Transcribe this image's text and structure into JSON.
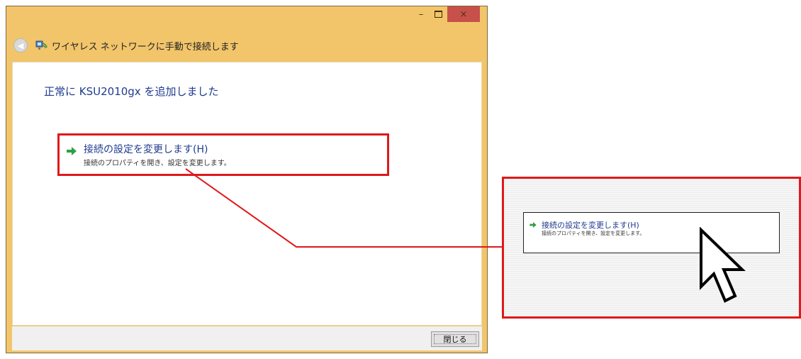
{
  "window": {
    "controls": {
      "minimize": "–",
      "maximize": "",
      "close": "×"
    },
    "address_title": "ワイヤレス ネットワークに手動で接続します",
    "heading": "正常に KSU2010gx を追加しました",
    "link": {
      "title": "接続の設定を変更します(H)",
      "description": "接続のプロパティを開き、設定を変更します。"
    },
    "close_button": "閉じる"
  },
  "callout": {
    "link": {
      "title": "接続の設定を変更します(H)",
      "description": "接続のプロパティを開き、設定を変更します。"
    }
  },
  "colors": {
    "window_frame": "#f2c56b",
    "highlight": "#e0191b",
    "link_text": "#1f3b8e",
    "arrow": "#2ea043"
  },
  "icons": [
    "back-arrow-icon",
    "wireless-network-icon",
    "green-arrow-icon",
    "mouse-pointer-icon"
  ]
}
